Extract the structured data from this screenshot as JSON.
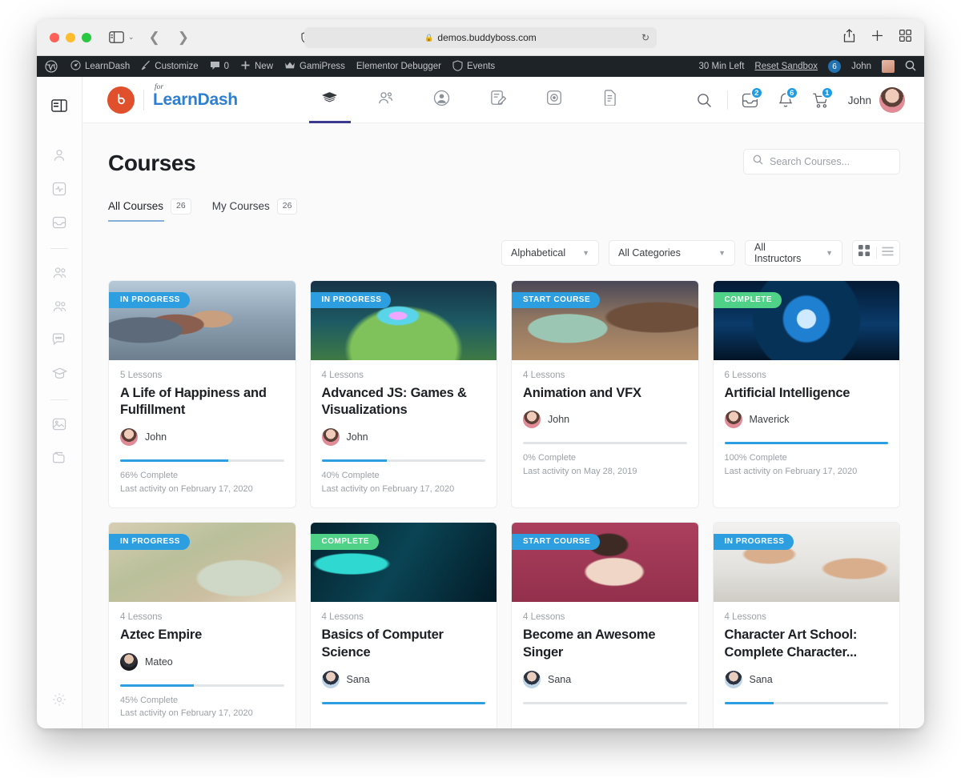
{
  "browser": {
    "url": "demos.buddyboss.com",
    "lock_icon": "lock-icon",
    "reload_icon": "reload-icon",
    "share_icon": "share-icon",
    "newtab_icon": "plus-icon",
    "tabs_icon": "tab-overview-icon",
    "back_icon": "back-chevron-icon",
    "forward_icon": "forward-chevron-icon",
    "sidebar_icon": "sidebar-toggle-icon",
    "shield_icon": "privacy-shield-icon"
  },
  "admin_bar": {
    "wp_logo": "wordpress-icon",
    "items": [
      {
        "label": "LearnDash",
        "icon": "dashboard-icon"
      },
      {
        "label": "Customize",
        "icon": "brush-icon"
      },
      {
        "label": "0",
        "icon": "comment-icon"
      },
      {
        "label": "New",
        "icon": "plus-icon"
      },
      {
        "label": "GamiPress",
        "icon": "crown-icon"
      },
      {
        "label": "Elementor Debugger",
        "icon": ""
      },
      {
        "label": "Events",
        "icon": "shield-icon"
      }
    ],
    "time_left": "30 Min Left",
    "reset_sandbox": "Reset Sandbox",
    "count": "6",
    "user": "John",
    "search_icon": "search-icon"
  },
  "rail": {
    "items": [
      {
        "name": "panel-toggle",
        "icon": "panel-icon"
      },
      {
        "name": "profile",
        "icon": "user-icon"
      },
      {
        "name": "activity",
        "icon": "activity-icon"
      },
      {
        "name": "inbox",
        "icon": "inbox-icon"
      },
      {
        "name": "members",
        "icon": "members-icon"
      },
      {
        "name": "groups",
        "icon": "groups-icon"
      },
      {
        "name": "forums",
        "icon": "chat-icon"
      },
      {
        "name": "courses",
        "icon": "graduation-cap-icon"
      },
      {
        "name": "photos",
        "icon": "image-icon"
      },
      {
        "name": "documents",
        "icon": "folder-icon"
      },
      {
        "name": "settings",
        "icon": "gear-icon"
      }
    ]
  },
  "header": {
    "logo_for": "for",
    "logo_text": "LearnDash",
    "logo_mark": "buddyboss-logo",
    "nav": [
      {
        "name": "courses",
        "icon": "graduation-cap-icon",
        "active": true
      },
      {
        "name": "members",
        "icon": "members-icon",
        "active": false
      },
      {
        "name": "profile",
        "icon": "user-circle-icon",
        "active": false
      },
      {
        "name": "assignments",
        "icon": "note-edit-icon",
        "active": false
      },
      {
        "name": "media",
        "icon": "camera-icon",
        "active": false
      },
      {
        "name": "documents",
        "icon": "document-icon",
        "active": false
      }
    ],
    "search_icon": "search-icon",
    "messages_badge": "2",
    "notifications_badge": "6",
    "cart_badge": "1",
    "user_name": "John"
  },
  "page": {
    "title": "Courses",
    "search_placeholder": "Search Courses...",
    "search_icon": "search-icon",
    "tabs": [
      {
        "label": "All Courses",
        "count": "26",
        "active": true
      },
      {
        "label": "My Courses",
        "count": "26",
        "active": false
      }
    ],
    "filters": [
      {
        "name": "sort",
        "value": "Alphabetical"
      },
      {
        "name": "categories",
        "value": "All Categories"
      },
      {
        "name": "instructors",
        "value": "All Instructors"
      }
    ],
    "view_grid_icon": "grid-view-icon",
    "view_list_icon": "list-view-icon"
  },
  "courses": [
    {
      "status": "IN PROGRESS",
      "status_kind": "progress",
      "lessons": "5 Lessons",
      "title": "A Life of Happiness and Fulfillment",
      "author": "John",
      "avatar": "pink",
      "progress": 66,
      "progress_label": "66% Complete",
      "activity": "Last activity on February 17, 2020",
      "art": "art1"
    },
    {
      "status": "IN PROGRESS",
      "status_kind": "progress",
      "lessons": "4 Lessons",
      "title": "Advanced JS: Games & Visualizations",
      "author": "John",
      "avatar": "pink",
      "progress": 40,
      "progress_label": "40% Complete",
      "activity": "Last activity on February 17, 2020",
      "art": "art2"
    },
    {
      "status": "START COURSE",
      "status_kind": "start",
      "lessons": "4 Lessons",
      "title": "Animation and VFX",
      "author": "John",
      "avatar": "pink",
      "progress": 0,
      "progress_label": "0% Complete",
      "activity": "Last activity on May 28, 2019",
      "art": "art3"
    },
    {
      "status": "COMPLETE",
      "status_kind": "complete",
      "lessons": "6 Lessons",
      "title": "Artificial Intelligence",
      "author": "Maverick",
      "avatar": "pink",
      "progress": 100,
      "progress_label": "100% Complete",
      "activity": "Last activity on February 17, 2020",
      "art": "art4"
    },
    {
      "status": "IN PROGRESS",
      "status_kind": "progress",
      "lessons": "4 Lessons",
      "title": "Aztec Empire",
      "author": "Mateo",
      "avatar": "dark",
      "progress": 45,
      "progress_label": "45% Complete",
      "activity": "Last activity on February 17, 2020",
      "art": "art5"
    },
    {
      "status": "COMPLETE",
      "status_kind": "complete",
      "lessons": "4 Lessons",
      "title": "Basics of Computer Science",
      "author": "Sana",
      "avatar": "blue",
      "progress": 100,
      "progress_label": "",
      "activity": "",
      "art": "art6"
    },
    {
      "status": "START COURSE",
      "status_kind": "start",
      "lessons": "4 Lessons",
      "title": "Become an Awesome Singer",
      "author": "Sana",
      "avatar": "blue",
      "progress": 0,
      "progress_label": "",
      "activity": "",
      "art": "art7"
    },
    {
      "status": "IN PROGRESS",
      "status_kind": "progress",
      "lessons": "4 Lessons",
      "title": "Character Art School: Complete Character...",
      "author": "Sana",
      "avatar": "blue",
      "progress": 30,
      "progress_label": "",
      "activity": "",
      "art": "art8"
    }
  ],
  "colors": {
    "accent_blue": "#2d9fe0",
    "complete_green": "#4fd288",
    "brand_orange": "#e0502c",
    "logo_blue": "#2e7fd1",
    "admin_bar": "#1d2327"
  }
}
